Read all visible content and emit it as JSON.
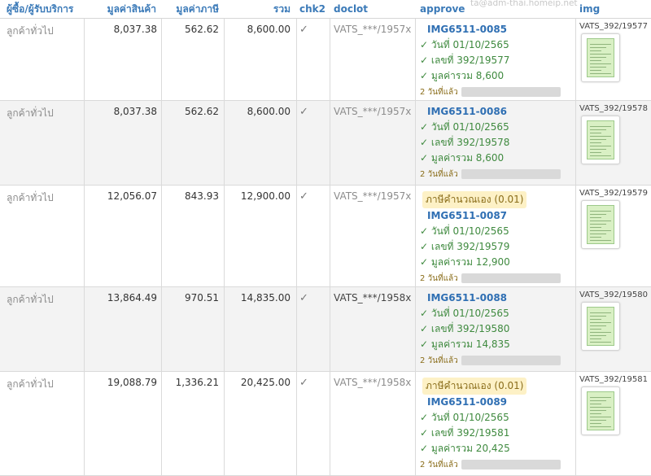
{
  "header": {
    "buyer": "ผู้ซื้อ/ผู้รับบริการ",
    "goods_value": "มูลค่าสินค้า",
    "tax_value": "มูลค่าภาษี",
    "total": "รวม",
    "chk2": "chk2",
    "doclot": "doclot",
    "approve": "approve",
    "img": "img",
    "watermark": "ta@adm-thai.homeip.net"
  },
  "rows": [
    {
      "buyer": "ลูกค้าทั่วไป",
      "goods": "8,037.38",
      "tax": "562.62",
      "total": "8,600.00",
      "chk": "✓",
      "doclot": "VATS_***/1957x",
      "doclot_dark": false,
      "warn": "",
      "img_id": "IMG6511-0085",
      "date": "✓ วันที่ 01/10/2565",
      "no": "✓ เลขที่ 392/19577",
      "sum": "✓ มูลค่ารวม 8,600",
      "ago": "2 วันที่แล้ว",
      "img_caption": "VATS_392/19577"
    },
    {
      "buyer": "ลูกค้าทั่วไป",
      "goods": "8,037.38",
      "tax": "562.62",
      "total": "8,600.00",
      "chk": "✓",
      "doclot": "VATS_***/1957x",
      "doclot_dark": false,
      "warn": "",
      "img_id": "IMG6511-0086",
      "date": "✓ วันที่ 01/10/2565",
      "no": "✓ เลขที่ 392/19578",
      "sum": "✓ มูลค่ารวม 8,600",
      "ago": "2 วันที่แล้ว",
      "img_caption": "VATS_392/19578"
    },
    {
      "buyer": "ลูกค้าทั่วไป",
      "goods": "12,056.07",
      "tax": "843.93",
      "total": "12,900.00",
      "chk": "✓",
      "doclot": "VATS_***/1957x",
      "doclot_dark": false,
      "warn": "ภาษีคำนวณเอง (0.01)",
      "img_id": "IMG6511-0087",
      "date": "✓ วันที่ 01/10/2565",
      "no": "✓ เลขที่ 392/19579",
      "sum": "✓ มูลค่ารวม 12,900",
      "ago": "2 วันที่แล้ว",
      "img_caption": "VATS_392/19579"
    },
    {
      "buyer": "ลูกค้าทั่วไป",
      "goods": "13,864.49",
      "tax": "970.51",
      "total": "14,835.00",
      "chk": "✓",
      "doclot": "VATS_***/1958x",
      "doclot_dark": true,
      "warn": "",
      "img_id": "IMG6511-0088",
      "date": "✓ วันที่ 01/10/2565",
      "no": "✓ เลขที่ 392/19580",
      "sum": "✓ มูลค่ารวม 14,835",
      "ago": "2 วันที่แล้ว",
      "img_caption": "VATS_392/19580"
    },
    {
      "buyer": "ลูกค้าทั่วไป",
      "goods": "19,088.79",
      "tax": "1,336.21",
      "total": "20,425.00",
      "chk": "✓",
      "doclot": "VATS_***/1958x",
      "doclot_dark": false,
      "warn": "ภาษีคำนวณเอง (0.01)",
      "img_id": "IMG6511-0089",
      "date": "✓ วันที่ 01/10/2565",
      "no": "✓ เลขที่ 392/19581",
      "sum": "✓ มูลค่ารวม 20,425",
      "ago": "2 วันที่แล้ว",
      "img_caption": "VATS_392/19581"
    }
  ]
}
